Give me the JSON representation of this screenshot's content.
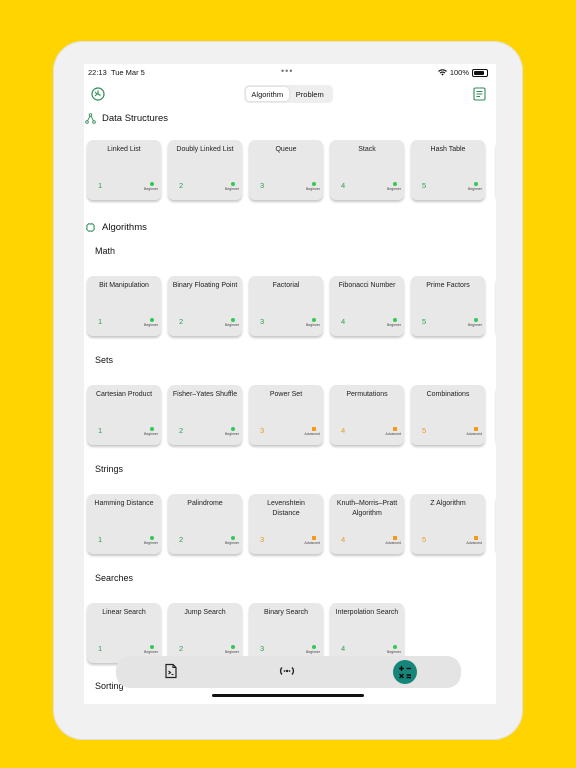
{
  "status": {
    "time": "22:13",
    "date": "Tue Mar 5",
    "dots": "•••",
    "battery": "100%"
  },
  "segmented": {
    "algorithm": "Algorithm",
    "problem": "Problem"
  },
  "sections": {
    "data_structures": "Data Structures",
    "algorithms": "Algorithms",
    "math": "Math",
    "sets": "Sets",
    "strings": "Strings",
    "searches": "Searches",
    "sorting": "Sorting"
  },
  "colors": {
    "beginner": "#34C759",
    "advanced": "#F29A1D",
    "num_green": "#2E9E4F",
    "num_orange": "#E89A20"
  },
  "levels": {
    "beginner": "Beginner",
    "advanced": "Advanced"
  },
  "rows": {
    "ds": [
      {
        "name": "Linked List",
        "num": "1",
        "level": "beginner"
      },
      {
        "name": "Doubly Linked List",
        "num": "2",
        "level": "beginner"
      },
      {
        "name": "Queue",
        "num": "3",
        "level": "beginner"
      },
      {
        "name": "Stack",
        "num": "4",
        "level": "beginner"
      },
      {
        "name": "Hash Table",
        "num": "5",
        "level": "beginner"
      }
    ],
    "math": [
      {
        "name": "Bit Manipulation",
        "num": "1",
        "level": "beginner"
      },
      {
        "name": "Binary Floating Point",
        "num": "2",
        "level": "beginner"
      },
      {
        "name": "Factorial",
        "num": "3",
        "level": "beginner"
      },
      {
        "name": "Fibonacci Number",
        "num": "4",
        "level": "beginner"
      },
      {
        "name": "Prime Factors",
        "num": "5",
        "level": "beginner"
      }
    ],
    "sets": [
      {
        "name": "Cartesian Product",
        "num": "1",
        "level": "beginner"
      },
      {
        "name": "Fisher–Yates Shuffle",
        "num": "2",
        "level": "beginner"
      },
      {
        "name": "Power Set",
        "num": "3",
        "level": "advanced"
      },
      {
        "name": "Permutations",
        "num": "4",
        "level": "advanced"
      },
      {
        "name": "Combinations",
        "num": "5",
        "level": "advanced"
      }
    ],
    "strings": [
      {
        "name": "Hamming Distance",
        "num": "1",
        "level": "beginner"
      },
      {
        "name": "Palindrome",
        "num": "2",
        "level": "beginner"
      },
      {
        "name": "Levenshtein Distance",
        "num": "3",
        "level": "advanced"
      },
      {
        "name": "Knuth–Morris–Pratt Algorithm",
        "num": "4",
        "level": "advanced"
      },
      {
        "name": "Z Algorithm",
        "num": "5",
        "level": "advanced"
      }
    ],
    "searches": [
      {
        "name": "Linear Search",
        "num": "1",
        "level": "beginner"
      },
      {
        "name": "Jump Search",
        "num": "2",
        "level": "beginner"
      },
      {
        "name": "Binary Search",
        "num": "3",
        "level": "beginner"
      },
      {
        "name": "Interpolation Search",
        "num": "4",
        "level": "beginner"
      }
    ]
  },
  "tabs": [
    {
      "icon": "code-file-icon"
    },
    {
      "icon": "broadcast-icon"
    },
    {
      "icon": "calculator-icon",
      "active": true
    }
  ]
}
